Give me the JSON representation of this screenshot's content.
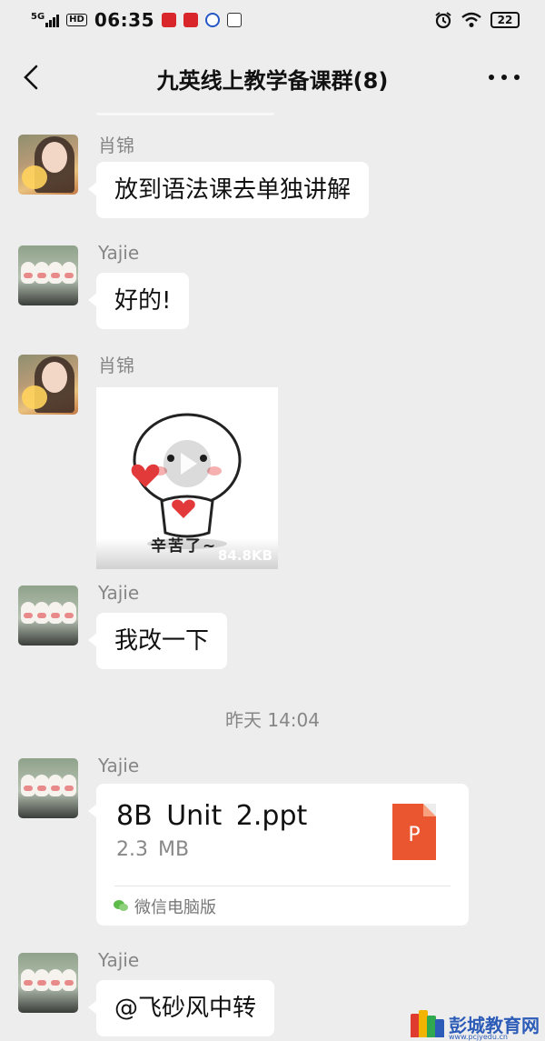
{
  "status_bar": {
    "network": "5G",
    "hd": "HD",
    "time": "06:35",
    "battery": "22"
  },
  "header": {
    "title": "九英线上教学备课群(8)"
  },
  "messages": [
    {
      "sender": "肖锦",
      "text": "放到语法课去单独讲解",
      "avatar": "girl-avatar"
    },
    {
      "sender": "Yajie",
      "text": "好的!",
      "avatar": "ducks-avatar"
    },
    {
      "sender": "肖锦",
      "sticker_caption": "辛苦了~",
      "sticker_size": "84.8KB",
      "avatar": "girl-avatar"
    },
    {
      "sender": "Yajie",
      "text": "我改一下",
      "avatar": "ducks-avatar"
    },
    {
      "sender": "Yajie",
      "file_name": "8B  Unit  2.ppt",
      "file_size": "2.3  MB",
      "file_icon_letter": "P",
      "file_source": "微信电脑版",
      "avatar": "ducks-avatar"
    },
    {
      "sender": "Yajie",
      "text": "@飞砂风中转",
      "avatar": "ducks-avatar"
    }
  ],
  "timestamp": "昨天  14:04",
  "watermark": {
    "text": "彭城教育网",
    "url": "www.pcjyedu.cn"
  },
  "colors": {
    "background": "#ededed",
    "bubble": "#ffffff",
    "meta_text": "#868686",
    "ppt_icon": "#e9562f"
  }
}
